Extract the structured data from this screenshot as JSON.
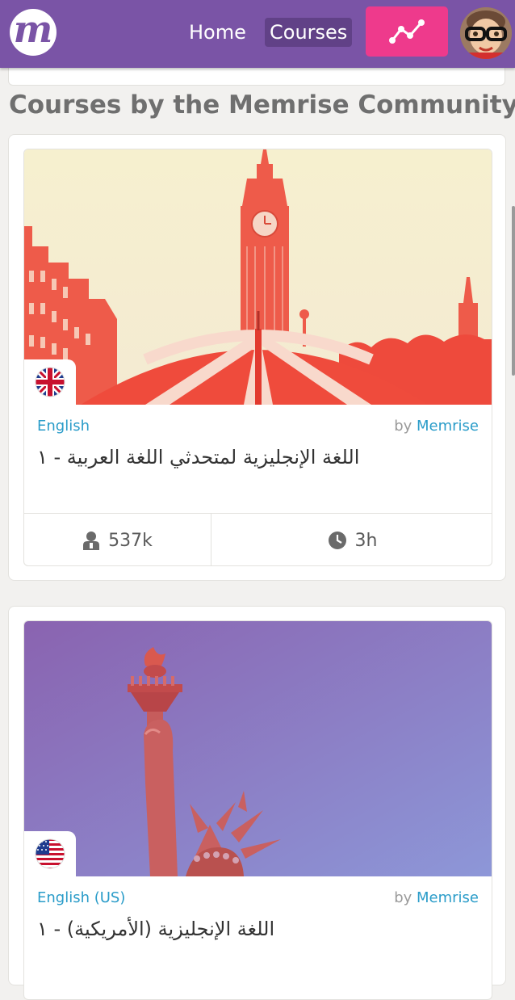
{
  "nav": {
    "logo_letter": "m",
    "home_label": "Home",
    "courses_label": "Courses"
  },
  "section": {
    "heading": "Courses by the Memrise Community"
  },
  "courses": [
    {
      "language": "English",
      "by_label": "by",
      "author": "Memrise",
      "title": "اللغة الإنجليزية لمتحدثي اللغة العربية - ١",
      "learners": "537k",
      "duration": "3h",
      "flag": "uk-flag-icon"
    },
    {
      "language": "English (US)",
      "by_label": "by",
      "author": "Memrise",
      "title": "اللغة الإنجليزية (الأمريكية) - ١",
      "flag": "us-flag-icon"
    }
  ],
  "colors": {
    "navbar": "#7a54a6",
    "active_tab": "#614187",
    "progress_button": "#ee3a8c",
    "link": "#2a9cc9"
  }
}
